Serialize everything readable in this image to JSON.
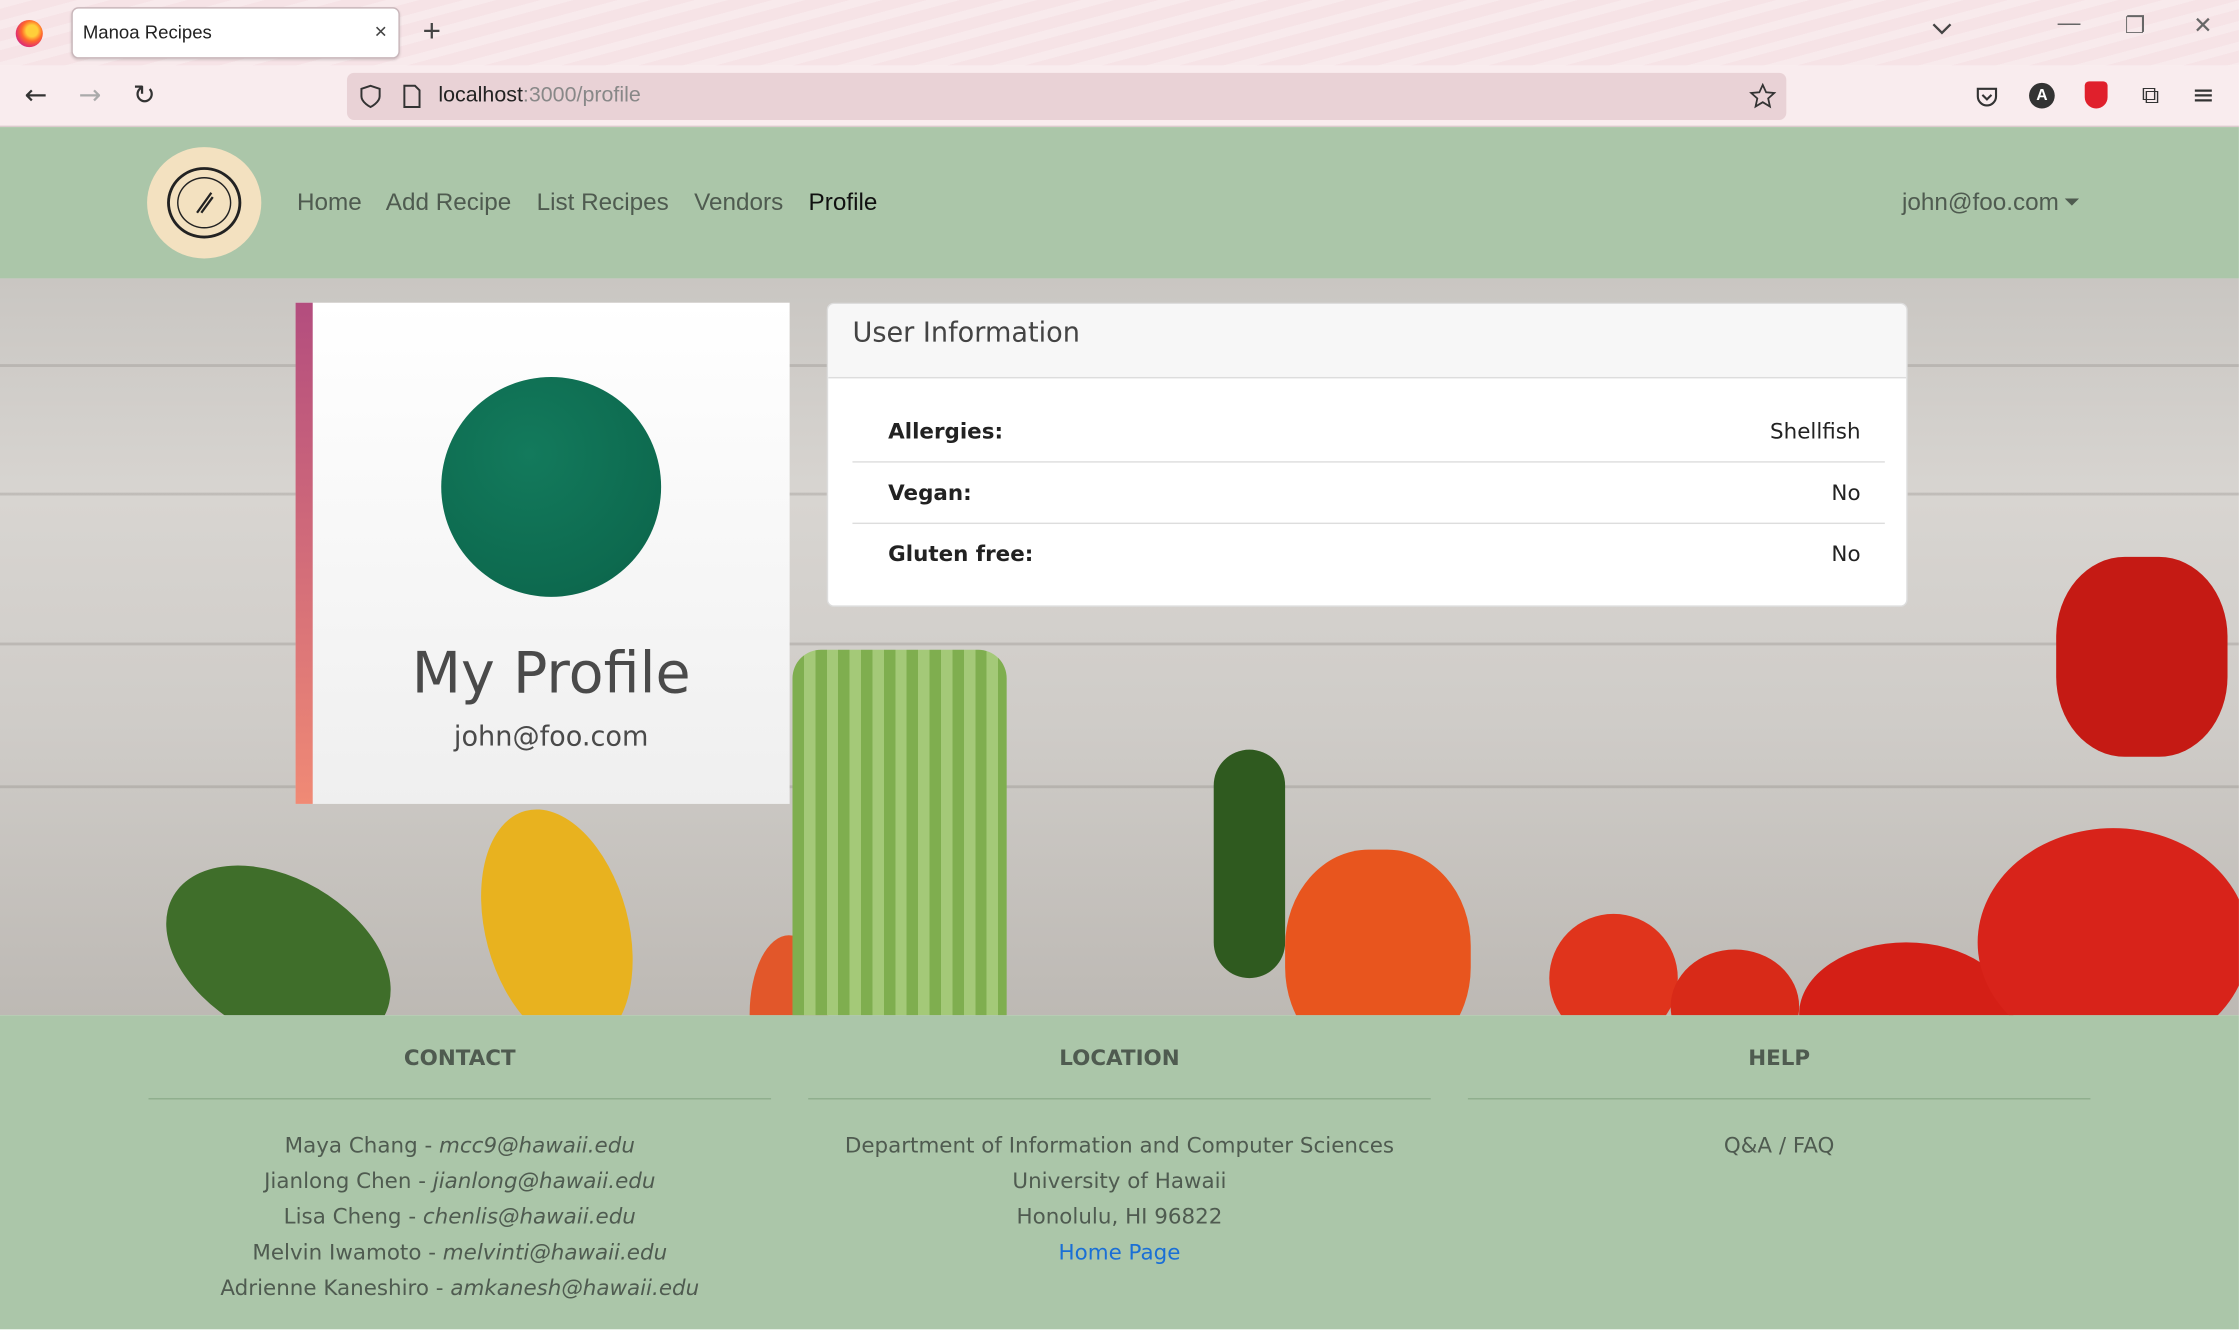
{
  "browser": {
    "tab_title": "Manoa Recipes",
    "tab_close": "×",
    "new_tab": "+",
    "url_host": "localhost",
    "url_path": ":3000/profile",
    "minimize": "—",
    "restore": "❐",
    "close": "✕",
    "profile_initial": "A"
  },
  "navbar": {
    "links": [
      "Home",
      "Add Recipe",
      "List Recipes",
      "Vendors",
      "Profile"
    ],
    "active": "Profile",
    "user": "john@foo.com"
  },
  "profile": {
    "title": "My Profile",
    "email": "john@foo.com"
  },
  "user_info": {
    "header": "User Information",
    "rows": [
      {
        "label": "Allergies:",
        "value": "Shellfish"
      },
      {
        "label": "Vegan:",
        "value": "No"
      },
      {
        "label": "Gluten free:",
        "value": "No"
      }
    ]
  },
  "footer": {
    "contact": {
      "heading": "CONTACT",
      "people": [
        {
          "name": "Maya Chang - ",
          "email": "mcc9@hawaii.edu"
        },
        {
          "name": "Jianlong Chen - ",
          "email": "jianlong@hawaii.edu"
        },
        {
          "name": "Lisa Cheng - ",
          "email": "chenlis@hawaii.edu"
        },
        {
          "name": "Melvin Iwamoto - ",
          "email": "melvinti@hawaii.edu"
        },
        {
          "name": "Adrienne Kaneshiro - ",
          "email": "amkanesh@hawaii.edu"
        }
      ]
    },
    "location": {
      "heading": "LOCATION",
      "lines": [
        "Department of Information and Computer Sciences",
        "University of Hawaii",
        "Honolulu, HI 96822"
      ],
      "link": "Home Page"
    },
    "help": {
      "heading": "HELP",
      "link": "Q&A / FAQ"
    }
  },
  "colors": {
    "navbar_bg": "#abc6a9",
    "accent_gradient_top": "#b34d7e",
    "accent_gradient_bottom": "#f08a75",
    "profile_pic": "#0d6a4f",
    "link": "#1a6fd6"
  }
}
